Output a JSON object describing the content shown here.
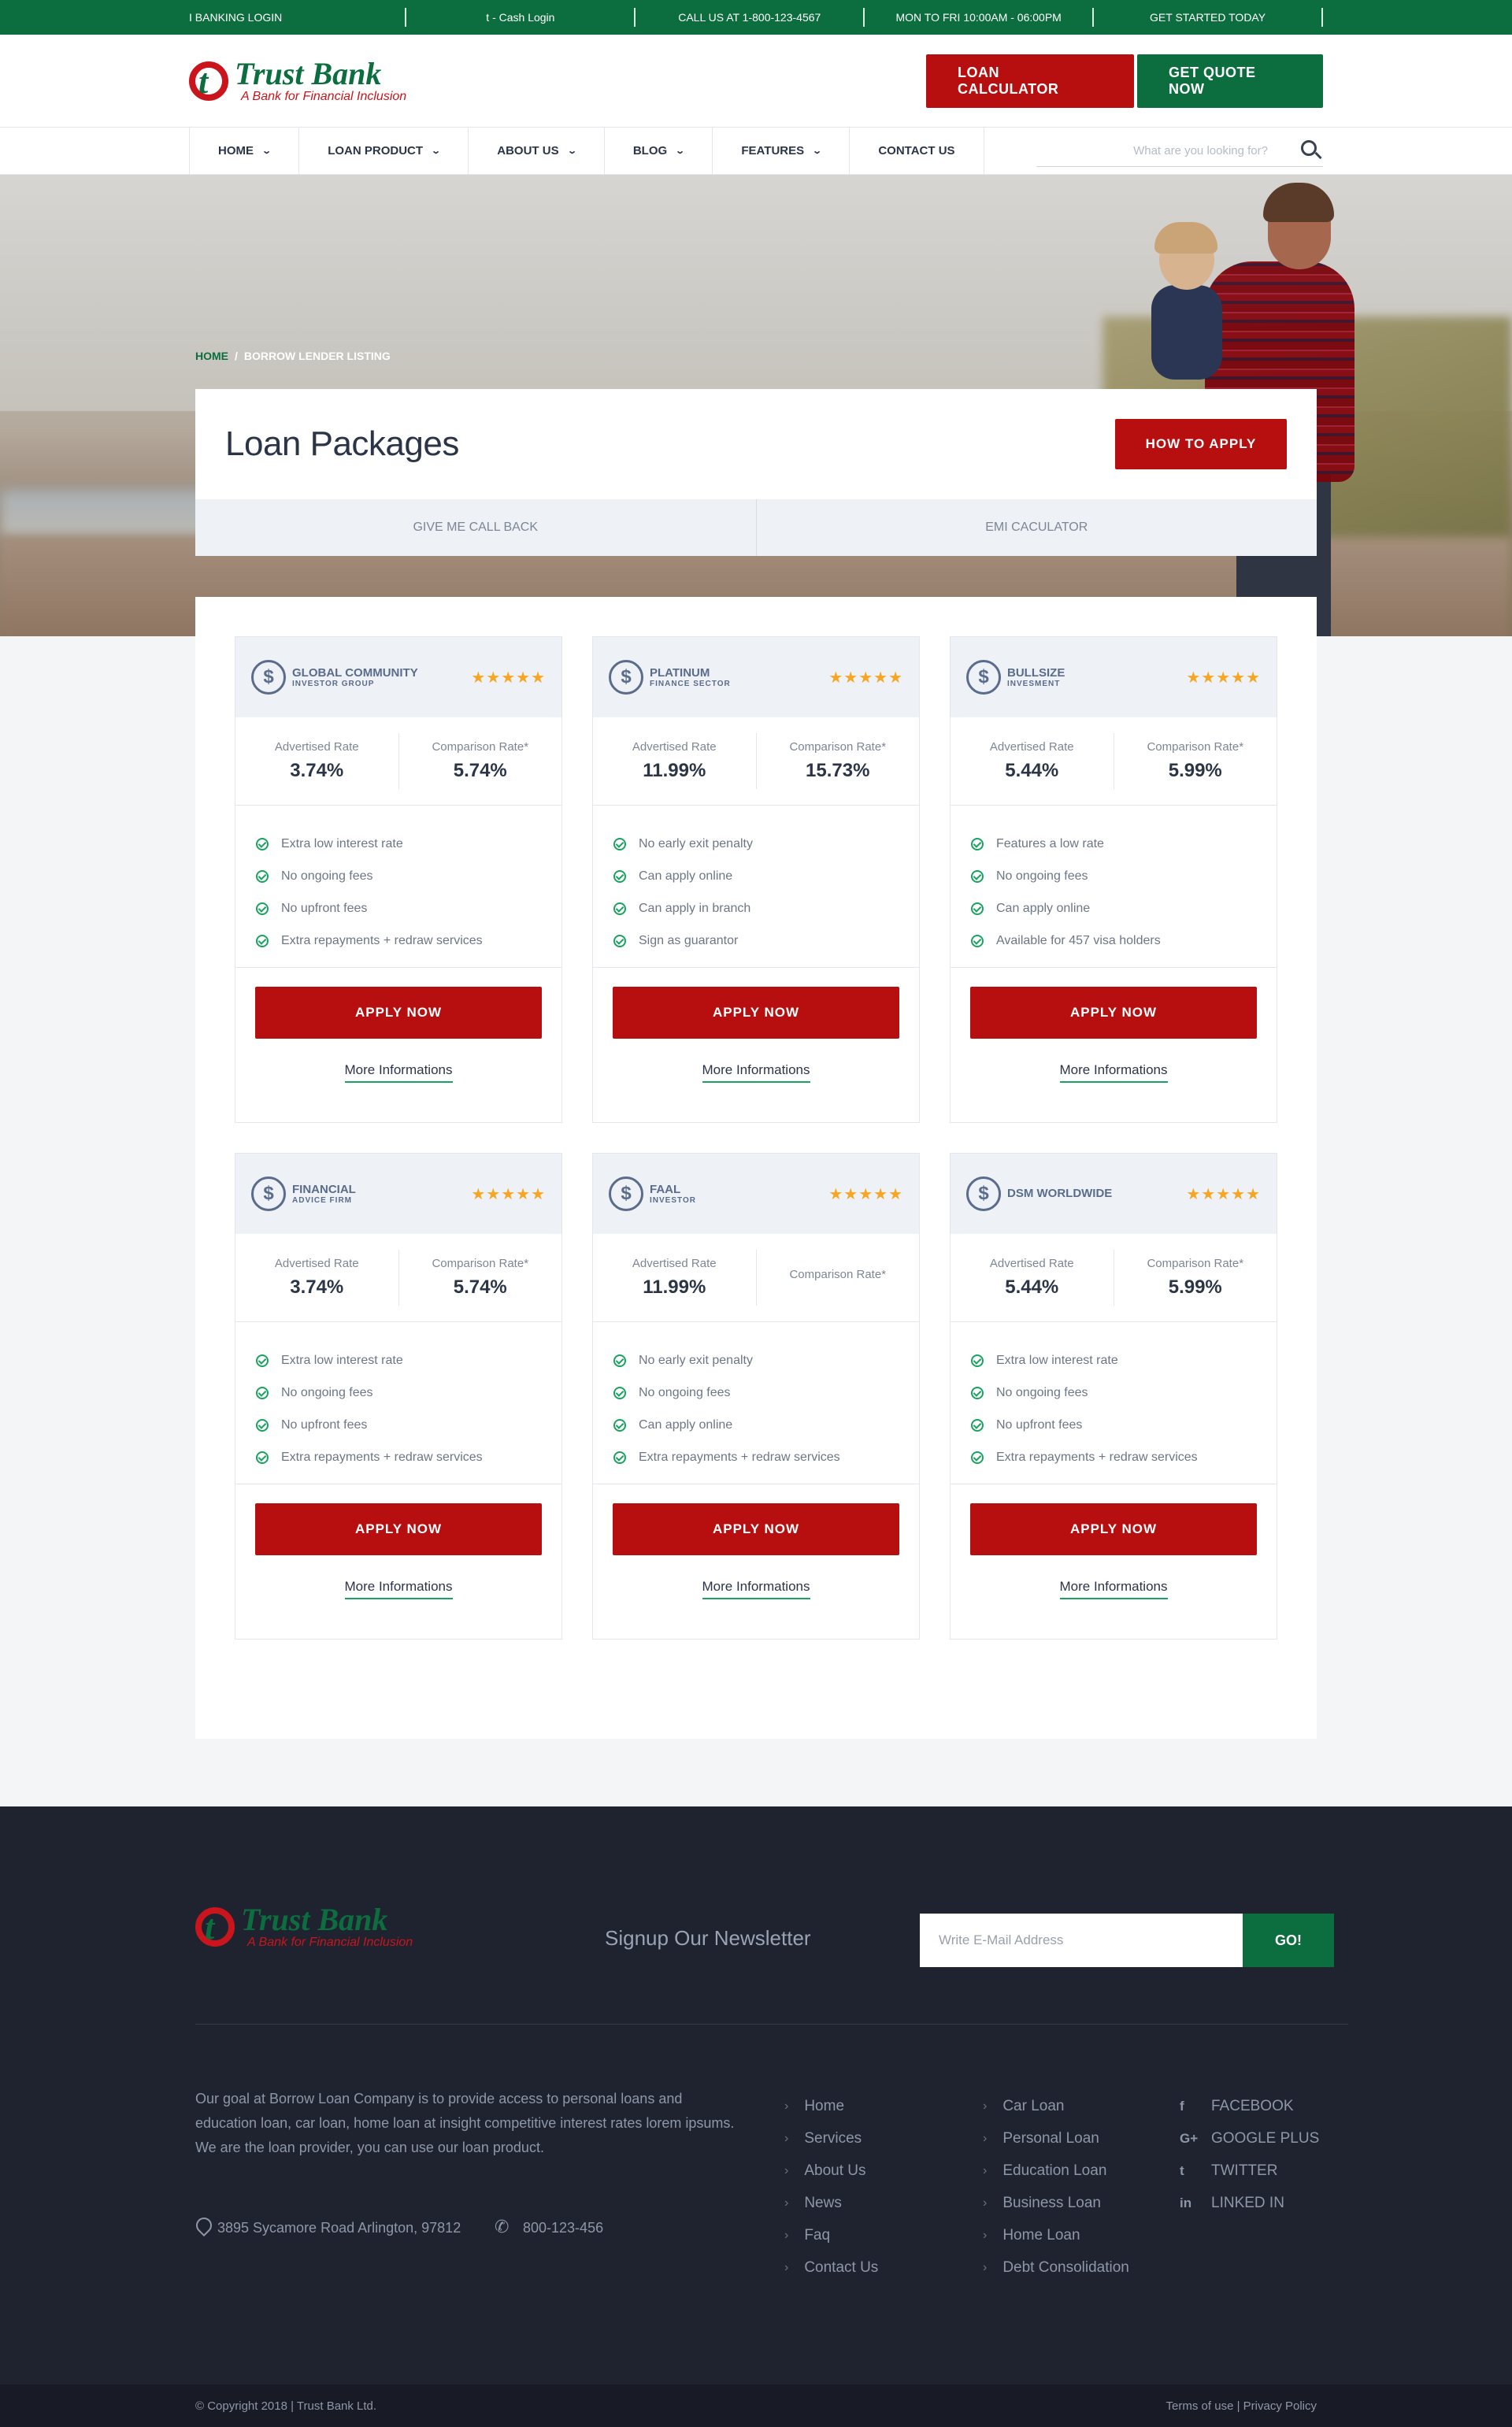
{
  "topbar": {
    "items": [
      "I BANKING LOGIN",
      "t - Cash Login",
      "CALL US AT 1-800-123-4567",
      "MON TO FRI 10:00AM - 06:00PM",
      "GET STARTED TODAY"
    ]
  },
  "header": {
    "logo_name": "Trust Bank",
    "logo_tagline": "A Bank for Financial Inclusion",
    "loan_calculator_label": "LOAN CALCULATOR",
    "get_quote_label": "GET QUOTE NOW"
  },
  "nav": {
    "items": [
      {
        "label": "HOME",
        "dropdown": true
      },
      {
        "label": "LOAN PRODUCT",
        "dropdown": true
      },
      {
        "label": "ABOUT US",
        "dropdown": true
      },
      {
        "label": "BLOG",
        "dropdown": true
      },
      {
        "label": "FEATURES",
        "dropdown": true
      },
      {
        "label": "CONTACT US",
        "dropdown": false
      }
    ],
    "search_placeholder": "What are you looking for?"
  },
  "hero": {
    "breadcrumb_home": "HOME",
    "breadcrumb_sep": "/",
    "breadcrumb_current": "BORROW LENDER LISTING",
    "title": "Loan Packages",
    "how_to_apply_label": "HOW TO APPLY",
    "tabs": [
      "GIVE ME CALL BACK",
      "EMI CACULATOR"
    ]
  },
  "cards": [
    {
      "brand": "GLOBAL COMMUNITY",
      "brand_sub": "INVESTOR GROUP",
      "stars": "★★★★★",
      "advertised_label": "Advertised Rate",
      "advertised": "3.74%",
      "comparison_label": "Comparison Rate*",
      "comparison": "5.74%",
      "features": [
        "Extra low interest rate",
        "No ongoing fees",
        "No upfront fees",
        "Extra repayments + redraw services"
      ],
      "apply_label": "APPLY NOW",
      "more_label": "More Informations"
    },
    {
      "brand": "PLATINUM",
      "brand_sub": "FINANCE SECTOR",
      "stars": "★★★★★",
      "advertised_label": "Advertised Rate",
      "advertised": "11.99%",
      "comparison_label": "Comparison Rate*",
      "comparison": "15.73%",
      "features": [
        "No early exit penalty",
        "Can apply online",
        "Can apply in branch",
        "Sign as guarantor"
      ],
      "apply_label": "APPLY NOW",
      "more_label": "More Informations"
    },
    {
      "brand": "BULLSIZE",
      "brand_sub": "INVESMENT",
      "stars": "★★★★★",
      "advertised_label": "Advertised Rate",
      "advertised": "5.44%",
      "comparison_label": "Comparison Rate*",
      "comparison": "5.99%",
      "features": [
        "Features a low rate",
        "No ongoing fees",
        "Can apply online",
        "Available for 457 visa holders"
      ],
      "apply_label": "APPLY NOW",
      "more_label": "More Informations"
    },
    {
      "brand": "FINANCIAL",
      "brand_sub": "ADVICE FIRM",
      "stars": "★★★★★",
      "advertised_label": "Advertised Rate",
      "advertised": "3.74%",
      "comparison_label": "Comparison Rate*",
      "comparison": "5.74%",
      "features": [
        "Extra low interest rate",
        "No ongoing fees",
        "No upfront fees",
        "Extra repayments + redraw services"
      ],
      "apply_label": "APPLY NOW",
      "more_label": "More Informations"
    },
    {
      "brand": "FAAL",
      "brand_sub": "INVESTOR",
      "stars": "★★★★★",
      "advertised_label": "Advertised Rate",
      "advertised": "11.99%",
      "comparison_label": "Comparison Rate*",
      "comparison": "",
      "features": [
        "No early exit penalty",
        "No ongoing fees",
        "Can apply online",
        "Extra repayments + redraw services"
      ],
      "apply_label": "APPLY NOW",
      "more_label": "More Informations"
    },
    {
      "brand": "DSM WORLDWIDE",
      "brand_sub": "",
      "stars": "★★★★★",
      "advertised_label": "Advertised Rate",
      "advertised": "5.44%",
      "comparison_label": "Comparison Rate*",
      "comparison": "5.99%",
      "features": [
        "Extra low interest rate",
        "No ongoing fees",
        "No upfront fees",
        "Extra repayments + redraw services"
      ],
      "apply_label": "APPLY NOW",
      "more_label": "More Informations"
    }
  ],
  "footer": {
    "logo_name": "Trust Bank",
    "logo_tagline": "A Bank for Financial Inclusion",
    "newsletter_label": "Signup Our Newsletter",
    "newsletter_placeholder": "Write E-Mail Address",
    "go_label": "GO!",
    "about": "Our goal at Borrow Loan Company is to provide access to personal loans and education loan, car loan, home loan at insight competitive interest rates lorem ipsums. We are the loan provider, you can use our loan product.",
    "address": "3895 Sycamore Road Arlington, 97812",
    "phone": "800-123-456",
    "links1": [
      "Home",
      "Services",
      "About Us",
      "News",
      "Faq",
      "Contact Us"
    ],
    "links2": [
      "Car Loan",
      "Personal Loan",
      "Education Loan",
      "Business Loan",
      "Home Loan",
      "Debt Consolidation"
    ],
    "social": [
      {
        "icon": "f",
        "label": "FACEBOOK"
      },
      {
        "icon": "G+",
        "label": "GOOGLE PLUS"
      },
      {
        "icon": "t",
        "label": "TWITTER"
      },
      {
        "icon": "in",
        "label": "LINKED IN"
      }
    ],
    "copyright": "© Copyright 2018 | Trust Bank Ltd.",
    "terms": "Terms of use | Privacy Policy"
  }
}
